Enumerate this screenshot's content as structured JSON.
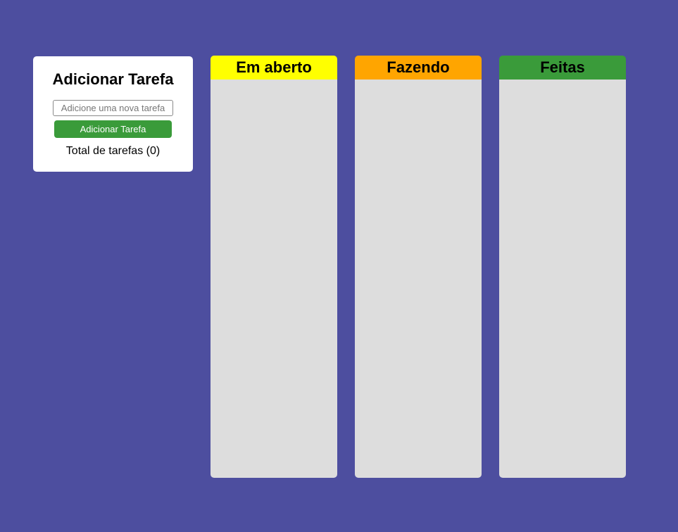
{
  "colors": {
    "page_background": "#4d4e9f",
    "card_background": "#ffffff",
    "button_green": "#3a9b3a",
    "column_body": "#dddddd",
    "open_header": "#ffff00",
    "doing_header": "#ffa500",
    "done_header": "#3a9b3a"
  },
  "add_panel": {
    "title": "Adicionar Tarefa",
    "input_placeholder": "Adicione uma nova tarefa",
    "input_value": "",
    "button_label": "Adicionar Tarefa",
    "total_label": "Total de tarefas (0)"
  },
  "columns": [
    {
      "title": "Em aberto",
      "tasks": []
    },
    {
      "title": "Fazendo",
      "tasks": []
    },
    {
      "title": "Feitas",
      "tasks": []
    }
  ]
}
